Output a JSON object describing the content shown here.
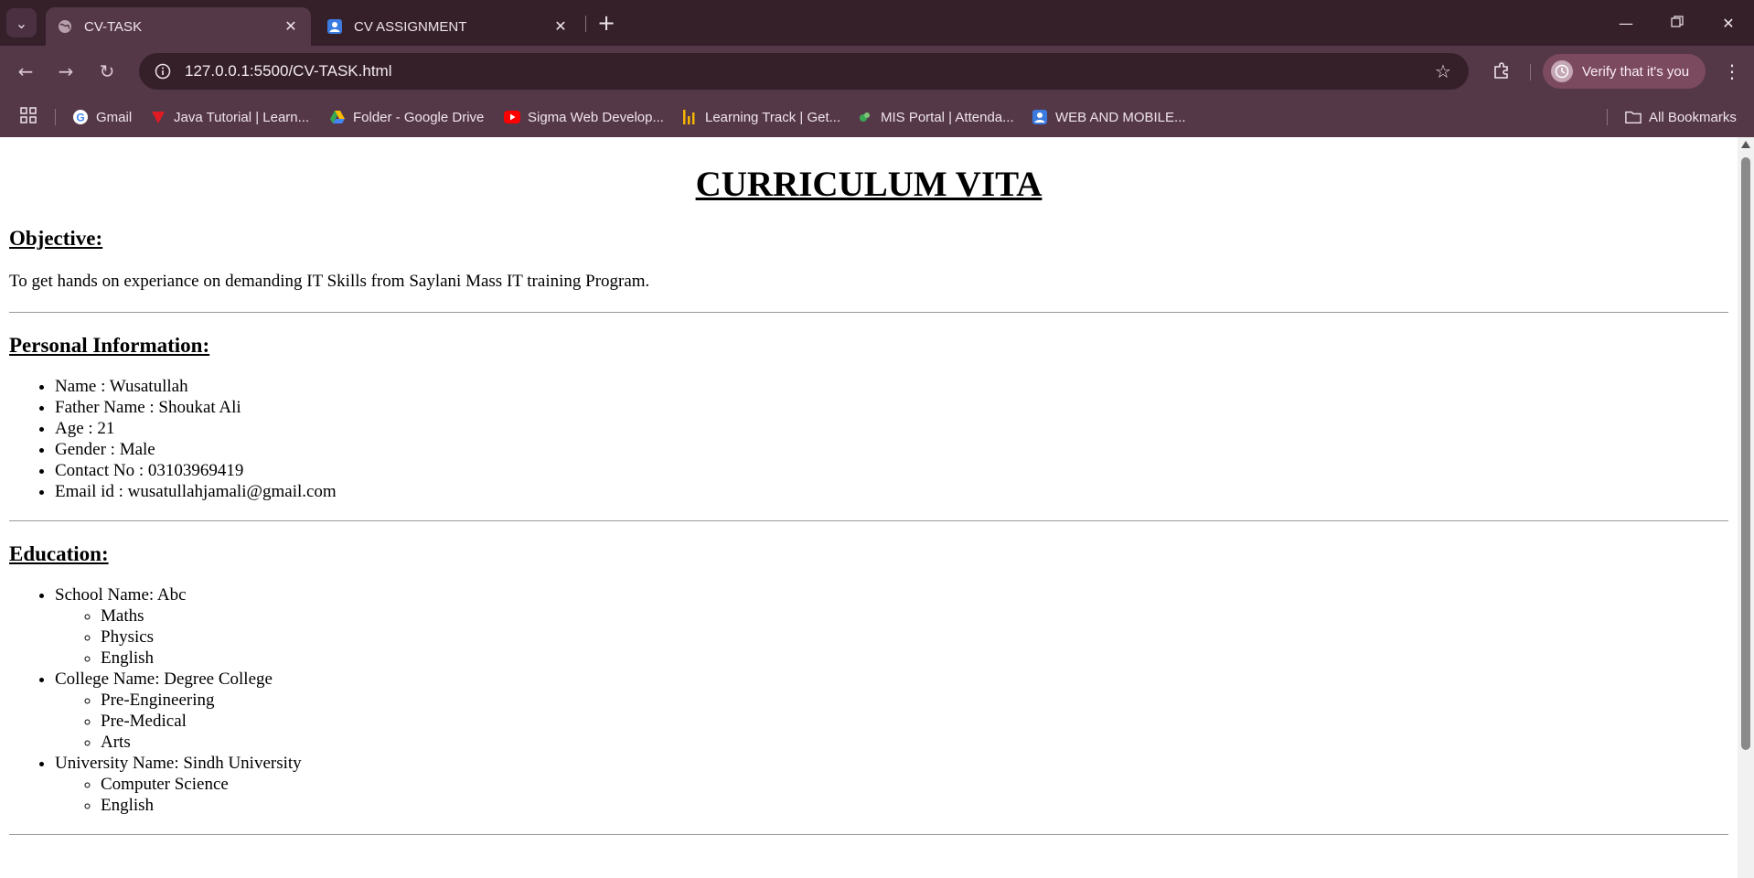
{
  "browser": {
    "tabs": [
      {
        "label": "CV-TASK",
        "active": true,
        "icon": "globe-icon"
      },
      {
        "label": "CV ASSIGNMENT",
        "active": false,
        "icon": "contacts-icon"
      }
    ],
    "address": "127.0.0.1:5500/CV-TASK.html",
    "verify_label": "Verify that it's you",
    "bookmarks": [
      {
        "label": "Gmail",
        "icon": "google-icon"
      },
      {
        "label": "Java Tutorial | Learn...",
        "icon": "java-icon"
      },
      {
        "label": "Folder - Google Drive",
        "icon": "drive-icon"
      },
      {
        "label": "Sigma Web Develop...",
        "icon": "youtube-icon"
      },
      {
        "label": "Learning Track | Get...",
        "icon": "chart-icon"
      },
      {
        "label": "MIS Portal | Attenda...",
        "icon": "mis-icon"
      },
      {
        "label": "WEB AND MOBILE...",
        "icon": "contacts-icon"
      }
    ],
    "all_bookmarks": "All Bookmarks"
  },
  "cv": {
    "title": "CURRICULUM VITA",
    "objective": {
      "heading": "Objective:",
      "text": "To get hands on experiance on demanding IT Skills from Saylani Mass IT training Program."
    },
    "personal": {
      "heading": "Personal Information:",
      "items": [
        "Name : Wusatullah",
        "Father Name : Shoukat Ali",
        "Age : 21",
        "Gender : Male",
        "Contact No : 03103969419",
        "Email id : wusatullahjamali@gmail.com"
      ]
    },
    "education": {
      "heading": "Education:",
      "institutions": [
        {
          "name": "School Name: Abc",
          "subjects": [
            "Maths",
            "Physics",
            "English"
          ]
        },
        {
          "name": "College Name: Degree College",
          "subjects": [
            "Pre-Engineering",
            "Pre-Medical",
            "Arts"
          ]
        },
        {
          "name": "University Name: Sindh University",
          "subjects": [
            "Computer Science",
            "English"
          ]
        }
      ]
    }
  },
  "colors": {
    "tab_strip": "#35202a",
    "toolbar": "#553848",
    "verify_pill": "#7b4a5f"
  }
}
